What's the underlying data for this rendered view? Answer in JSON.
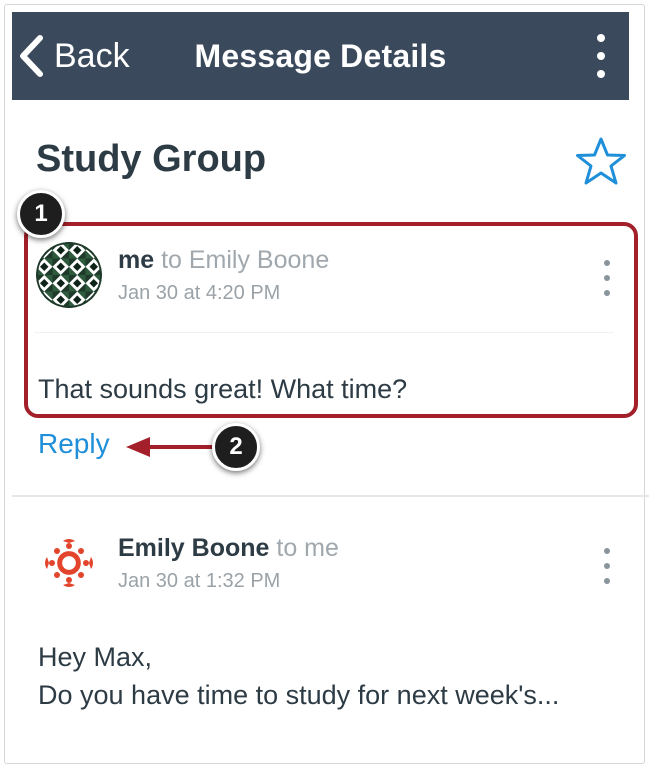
{
  "navbar": {
    "back_label": "Back",
    "title": "Message Details",
    "back_icon": "chevron-left-icon",
    "more_icon": "vertical-ellipsis-icon",
    "background_color": "#3a4a5c"
  },
  "conversation": {
    "title": "Study Group",
    "star_icon": "star-outline-icon",
    "accent_color": "#1f8fd9"
  },
  "messages": [
    {
      "sender": "me",
      "to_text": " to Emily Boone",
      "date": "Jan 30 at 4:20 PM",
      "body": "That sounds great! What time?",
      "avatar_icon": "geometric-pattern-avatar"
    },
    {
      "sender": "Emily Boone",
      "to_text": " to me",
      "date": "Jan 30 at 1:32 PM",
      "body_lines": [
        "Hey Max,",
        "Do you have time to study for next week's..."
      ],
      "avatar_icon": "canvas-logo-avatar"
    }
  ],
  "reply": {
    "label": "Reply"
  },
  "callouts": {
    "one": "1",
    "two": "2",
    "color": "#a3202a"
  }
}
